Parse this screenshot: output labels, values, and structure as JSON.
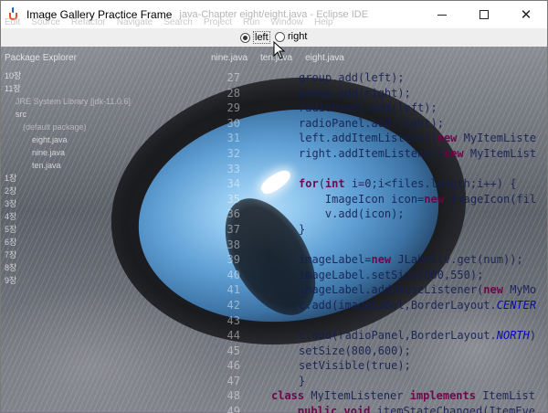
{
  "window": {
    "title": "Image Gallery Practice Frame",
    "ghost_title": "java-Chapter eight/eight.java - Eclipse IDE",
    "controls": {
      "minimize": "—",
      "maximize": "☐",
      "close": "✕"
    }
  },
  "ghost_menu": [
    "Edit",
    "Source",
    "Refactor",
    "Navigate",
    "Search",
    "Project",
    "Run",
    "Window",
    "Help"
  ],
  "radio_panel": {
    "left_label": "left",
    "right_label": "right",
    "selected": "left"
  },
  "ghost_ide": {
    "package_explorer_title": "Package Explorer",
    "editor_tabs": [
      "nine.java",
      "ten.java",
      "eight.java"
    ],
    "tree": [
      {
        "label": "10장",
        "dim": false
      },
      {
        "label": "11장",
        "dim": false
      },
      {
        "label": "JRE System Library [jdk-11.0.6]",
        "dim": true
      },
      {
        "label": "src",
        "dim": false
      },
      {
        "label": "(default package)",
        "dim": true
      },
      {
        "label": "eight.java",
        "dim": false
      },
      {
        "label": "nine.java",
        "dim": false
      },
      {
        "label": "ten.java",
        "dim": false
      },
      {
        "label": "1장",
        "dim": false
      },
      {
        "label": "2장",
        "dim": false
      },
      {
        "label": "3장",
        "dim": false
      },
      {
        "label": "4장",
        "dim": false
      },
      {
        "label": "5장",
        "dim": false
      },
      {
        "label": "6장",
        "dim": false
      },
      {
        "label": "7장",
        "dim": false
      },
      {
        "label": "8장",
        "dim": false
      },
      {
        "label": "9장",
        "dim": false
      }
    ],
    "line_numbers": [
      "27",
      "28",
      "29",
      "30",
      "31",
      "32",
      "33",
      "34",
      "35",
      "36",
      "37",
      "38",
      "39",
      "40",
      "41",
      "42",
      "43",
      "44",
      "45",
      "46",
      "47",
      "48",
      "49"
    ],
    "code_lines": [
      "group.add(left);",
      "group.add(right);",
      "radioPanel.add(left);",
      "radioPanel.add(right);",
      "left.addItemListener(new MyItemListe",
      "right.addItemListener(new MyItemList",
      "",
      "for(int i=0;i<files.length;i++) {",
      "    ImageIcon icon=new ImageIcon(fil",
      "    v.add(icon);",
      "}",
      "",
      "imageLabel=new JLabel(v.get(num));",
      "imageLabel.setSize(800,550);",
      "imageLabel.addMouseListener(new MyMo",
      "c.add(imageLabel,BorderLayout.CENTER",
      "",
      "c.add(radioPanel,BorderLayout.NORTH)",
      "setSize(800,600);",
      "setVisible(true);",
      "}",
      "class MyItemListener implements ItemList",
      "    public void itemStateChanged(ItemEve"
    ]
  },
  "image": {
    "subject": "close-up cat eye with blue iris"
  },
  "colors": {
    "iris": "#5f9fd4",
    "fur": "#7e8189",
    "keyword": "#6e0046",
    "constant": "#0000be",
    "panel_bg": "#eeeeee"
  }
}
